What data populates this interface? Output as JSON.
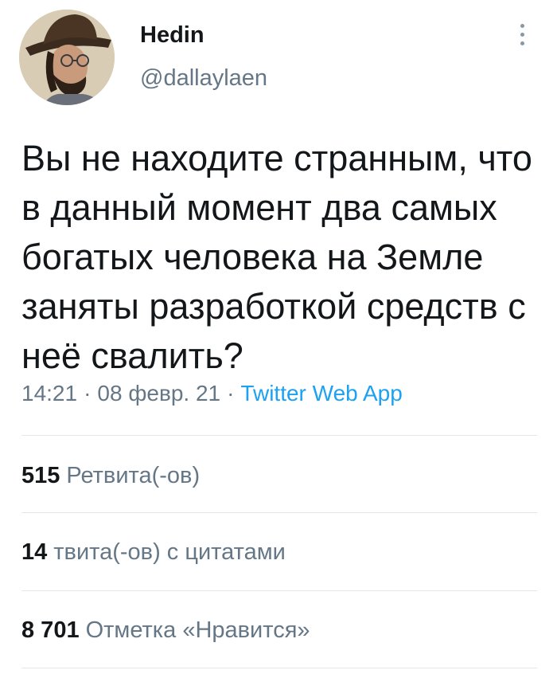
{
  "author": {
    "display_name": "Hedin",
    "handle": "@dallaylaen",
    "avatar_icon": "user-avatar-icon"
  },
  "tweet": {
    "text": "Вы не находите странным, что в данный момент два самых богатых человека на Земле заняты разработкой средств с неё свалить?",
    "time": "14:21",
    "separator": "·",
    "date": "08 февр. 21",
    "source": "Twitter Web App"
  },
  "stats": {
    "retweets": {
      "count": "515",
      "label": "Ретвита(-ов)"
    },
    "quotes": {
      "count": "14",
      "label": "твита(-ов) с цитатами"
    },
    "likes": {
      "count": "8 701",
      "label": "Отметка «Нравится»"
    }
  },
  "menu_icon": "more-vertical-icon",
  "colors": {
    "text_primary": "#14171a",
    "text_secondary": "#657786",
    "accent": "#1da1f2",
    "divider": "#e1e8ed"
  }
}
